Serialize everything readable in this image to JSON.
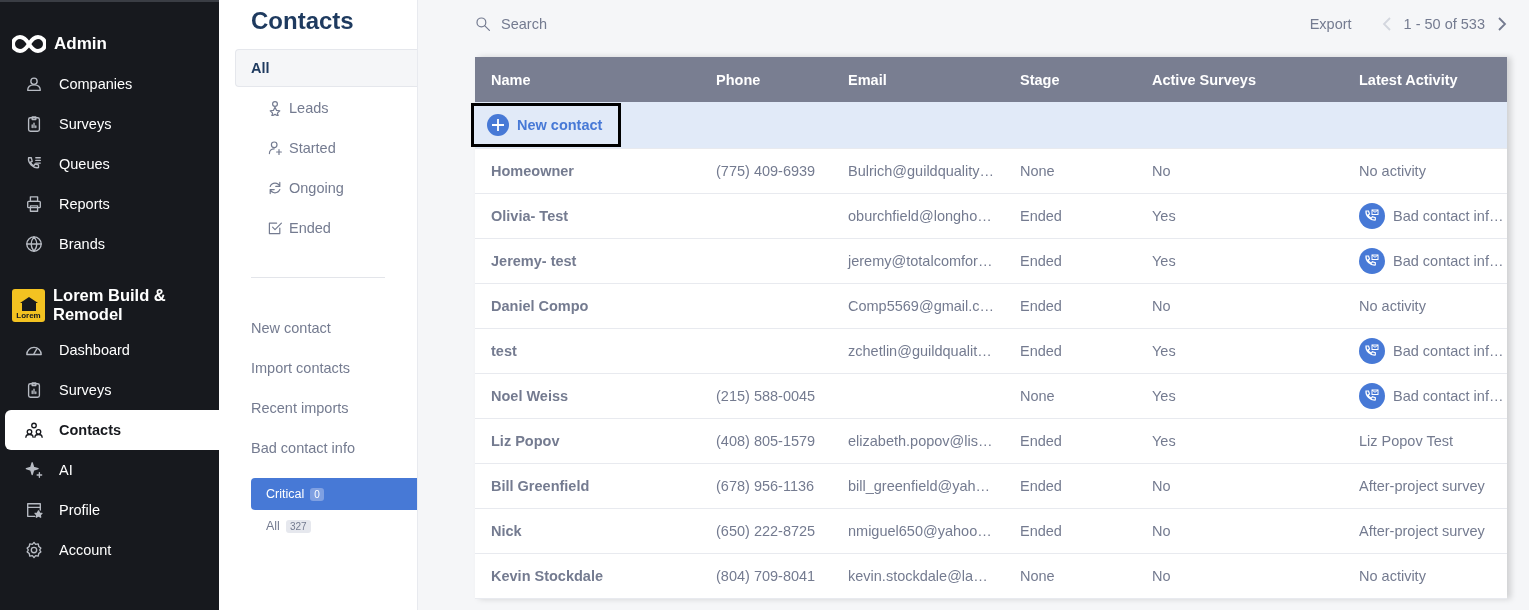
{
  "sidebar": {
    "admin_title": "Admin",
    "admin_items": [
      {
        "label": "Companies",
        "selected": false
      },
      {
        "label": "Surveys",
        "selected": false
      },
      {
        "label": "Queues",
        "selected": false
      },
      {
        "label": "Reports",
        "selected": false
      },
      {
        "label": "Brands",
        "selected": false
      }
    ],
    "company_title": "Lorem Build & Remodel",
    "company_logo_text": "Lorem",
    "company_items": [
      {
        "label": "Dashboard",
        "selected": false
      },
      {
        "label": "Surveys",
        "selected": false
      },
      {
        "label": "Contacts",
        "selected": true
      },
      {
        "label": "AI",
        "selected": false
      },
      {
        "label": "Profile",
        "selected": false
      },
      {
        "label": "Account",
        "selected": false
      }
    ]
  },
  "subnav": {
    "title": "Contacts",
    "filters": [
      {
        "label": "All",
        "selected": true
      },
      {
        "label": "Leads",
        "selected": false
      },
      {
        "label": "Started",
        "selected": false
      },
      {
        "label": "Ongoing",
        "selected": false
      },
      {
        "label": "Ended",
        "selected": false
      }
    ],
    "links": [
      "New contact",
      "Import contacts",
      "Recent imports",
      "Bad contact info"
    ],
    "bad_contact_filters": [
      {
        "label": "Critical",
        "count": "0",
        "selected": true
      },
      {
        "label": "All",
        "count": "327",
        "selected": false
      }
    ]
  },
  "toolbar": {
    "search_placeholder": "Search",
    "export": "Export",
    "pagination": "1 - 50 of 533",
    "prev_disabled": true,
    "next_disabled": false
  },
  "table": {
    "columns": [
      "Name",
      "Phone",
      "Email",
      "Stage",
      "Active Surveys",
      "Latest Activity"
    ],
    "new_contact": "New contact",
    "rows": [
      {
        "name": "Homeowner",
        "phone": "(775) 409-6939",
        "email": "Bulrich@guildquality…",
        "stage": "None",
        "active_surveys": "No",
        "latest_activity": "No activity",
        "kind": "plain"
      },
      {
        "name": "Olivia- Test",
        "phone": "",
        "email": "oburchfield@longho…",
        "stage": "Ended",
        "active_surveys": "Yes",
        "latest_activity": "Bad contact inf…",
        "kind": "alert"
      },
      {
        "name": "Jeremy- test",
        "phone": "",
        "email": "jeremy@totalcomfor…",
        "stage": "Ended",
        "active_surveys": "Yes",
        "latest_activity": "Bad contact inf…",
        "kind": "alert"
      },
      {
        "name": "Daniel Compo",
        "phone": "",
        "email": "Comp5569@gmail.c…",
        "stage": "Ended",
        "active_surveys": "No",
        "latest_activity": "No activity",
        "kind": "plain"
      },
      {
        "name": "test",
        "phone": "",
        "email": "zchetlin@guildqualit…",
        "stage": "Ended",
        "active_surveys": "Yes",
        "latest_activity": "Bad contact inf…",
        "kind": "alert"
      },
      {
        "name": "Noel Weiss",
        "phone": "(215) 588-0045",
        "email": "",
        "stage": "None",
        "active_surveys": "Yes",
        "latest_activity": "Bad contact inf…",
        "kind": "alert"
      },
      {
        "name": "Liz Popov",
        "phone": "(408) 805-1579",
        "email": "elizabeth.popov@lis…",
        "stage": "Ended",
        "active_surveys": "Yes",
        "latest_activity": "Liz Popov Test",
        "kind": "plain"
      },
      {
        "name": "Bill Greenfield",
        "phone": "(678) 956-1136",
        "email": "bill_greenfield@yah…",
        "stage": "Ended",
        "active_surveys": "No",
        "latest_activity": "After-project survey",
        "kind": "plain"
      },
      {
        "name": "Nick",
        "phone": "(650) 222-8725",
        "email": "nmiguel650@yahoo…",
        "stage": "Ended",
        "active_surveys": "No",
        "latest_activity": "After-project survey",
        "kind": "plain"
      },
      {
        "name": "Kevin Stockdale",
        "phone": "(804) 709-8041",
        "email": "kevin.stockdale@la…",
        "stage": "None",
        "active_surveys": "No",
        "latest_activity": "No activity",
        "kind": "plain"
      }
    ]
  }
}
